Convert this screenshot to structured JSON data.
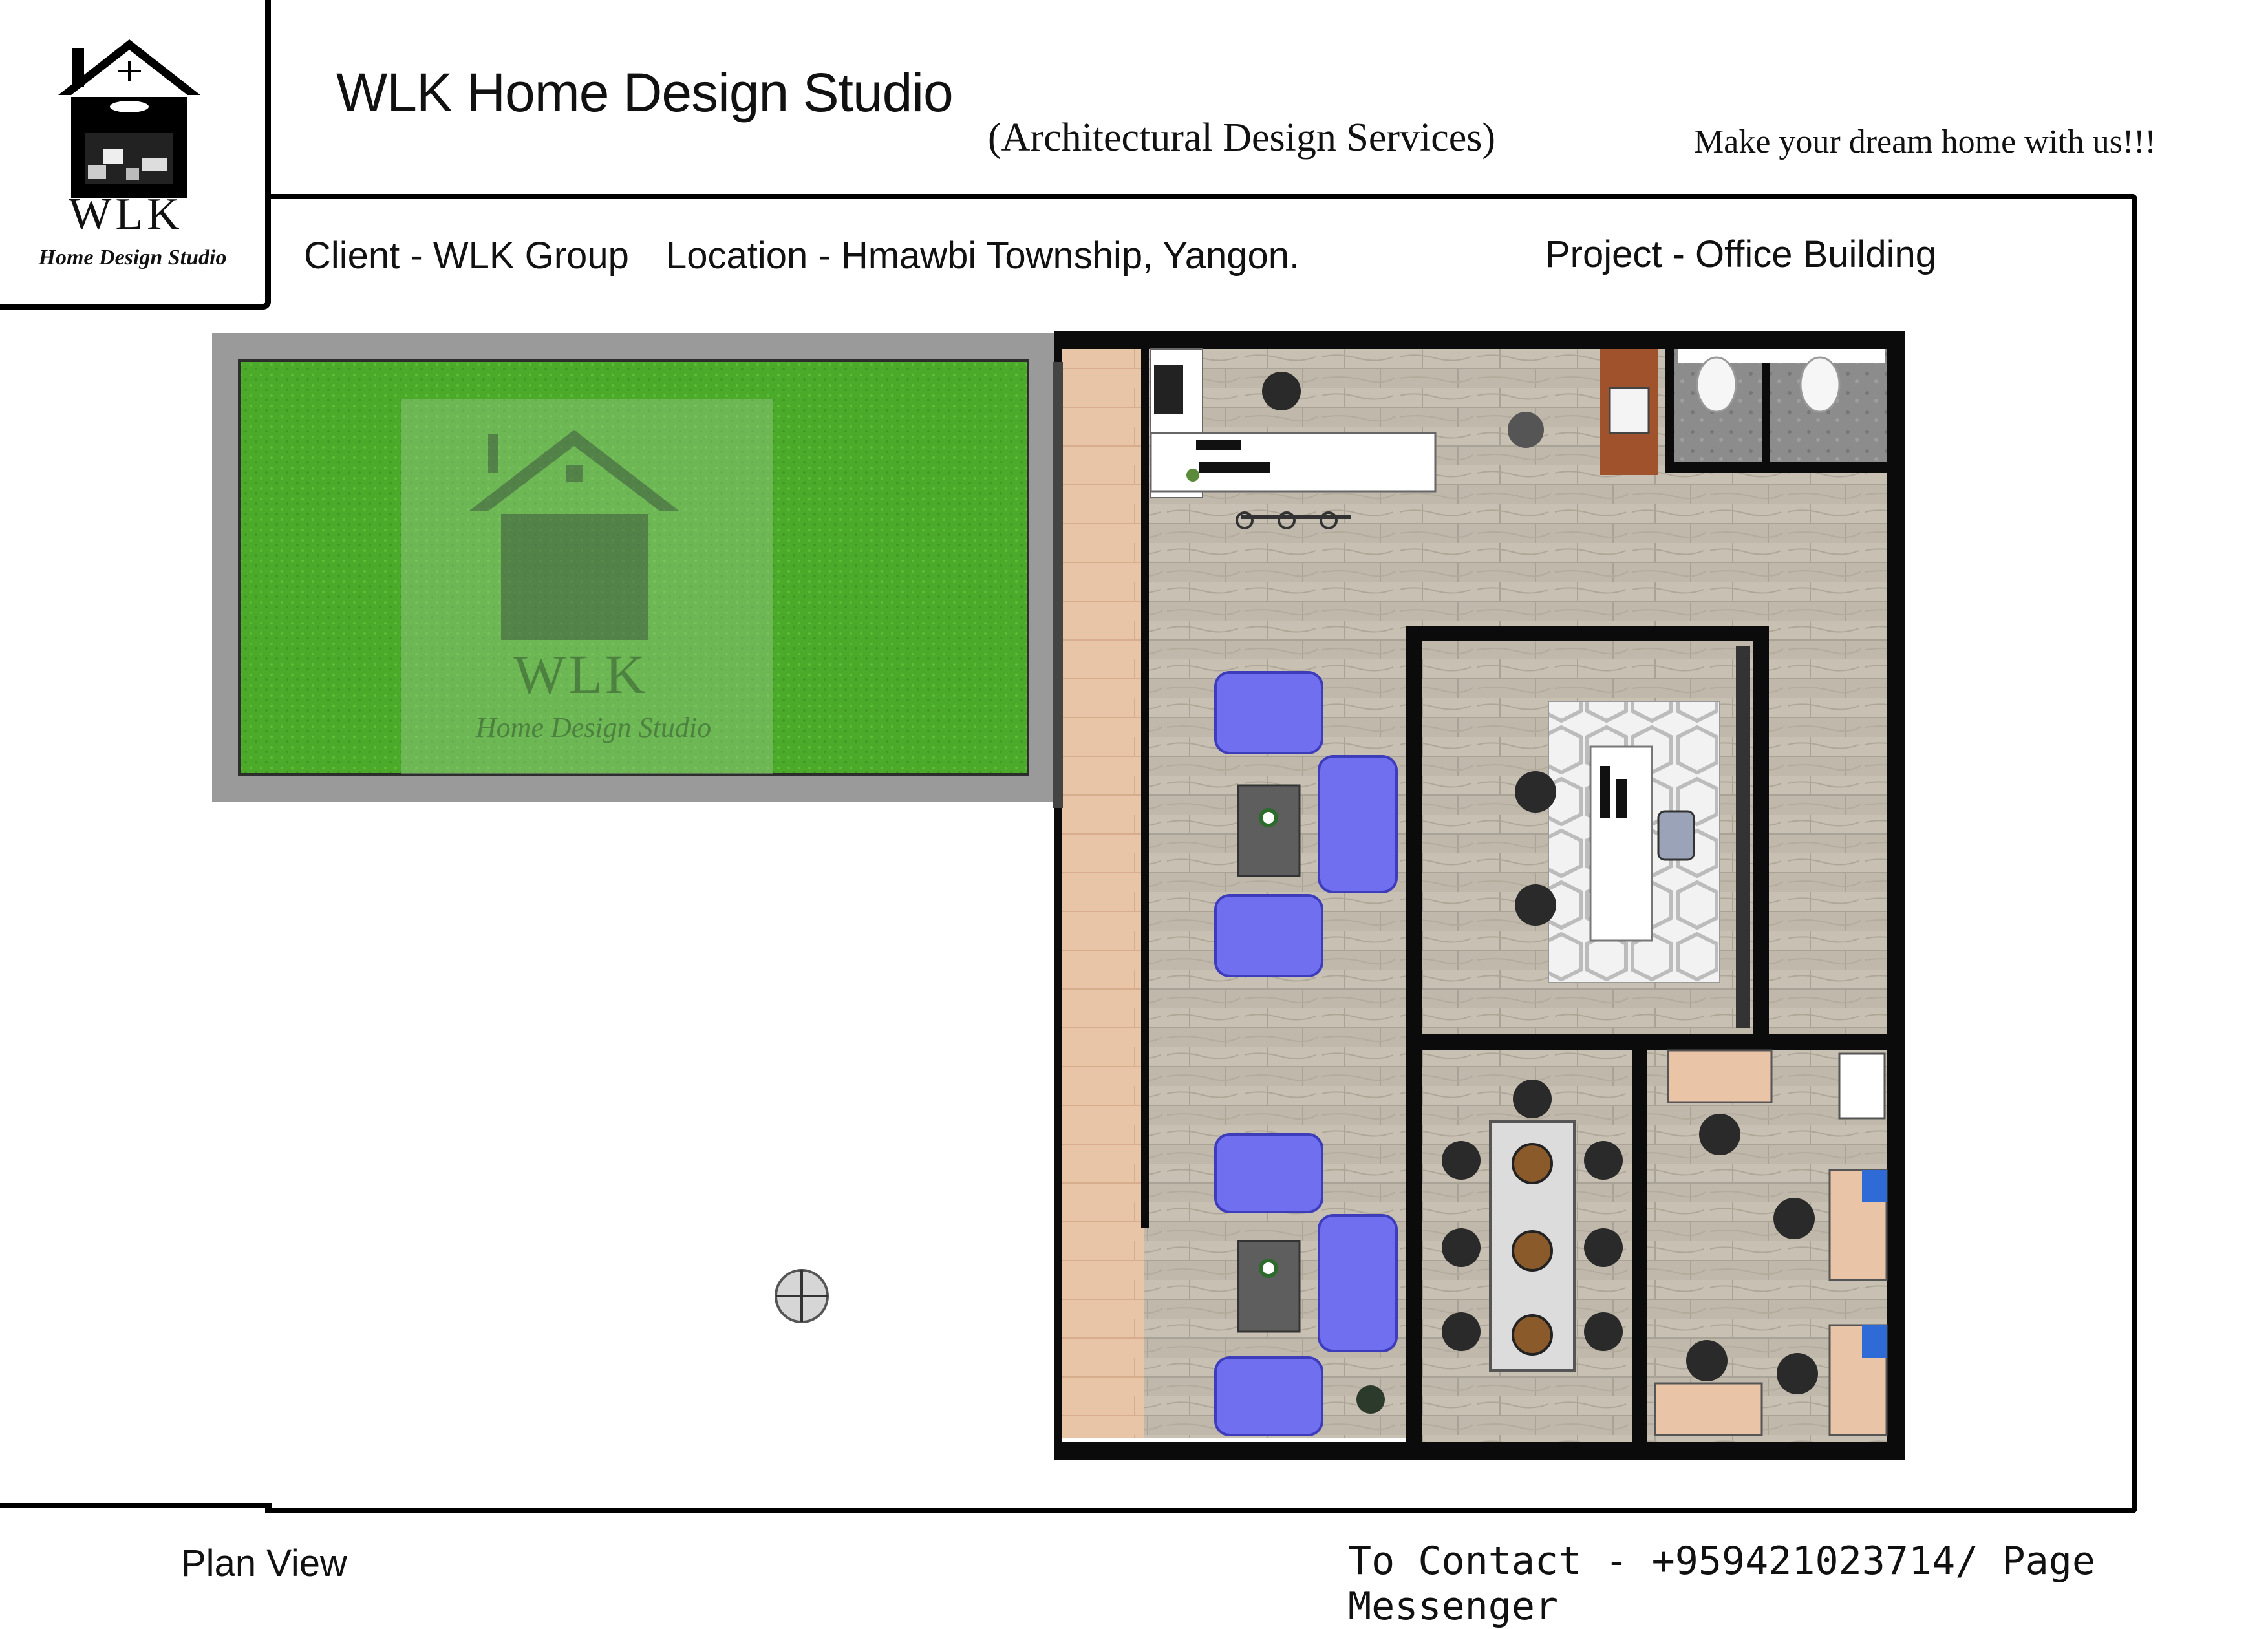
{
  "header": {
    "logo": {
      "brand": "WLK",
      "tagline": "Home Design Studio"
    },
    "studio_name": "WLK Home Design Studio",
    "services": "(Architectural Design Services)",
    "slogan": "Make your dream home with us!!!"
  },
  "project_info": {
    "client": "Client - WLK Group",
    "location": "Location - Hmawbi Township, Yangon.",
    "project": "Project - Office Building"
  },
  "plan": {
    "watermark": {
      "brand": "WLK",
      "tagline": "Home Design Studio"
    },
    "colors": {
      "grass": "#4caf2c",
      "floor": "#bdb6a9",
      "walkway": "#e9c4a6",
      "wall": "#0b0b0b",
      "sofa": "#6f6ff0",
      "table": "#5e5e5e",
      "counter": "#ffffff",
      "wood": "#a0522d",
      "tile": "#8a8a8a"
    }
  },
  "footer": {
    "view_label": "Plan View",
    "contact": "To Contact - +959421023714/ Page Messenger"
  }
}
